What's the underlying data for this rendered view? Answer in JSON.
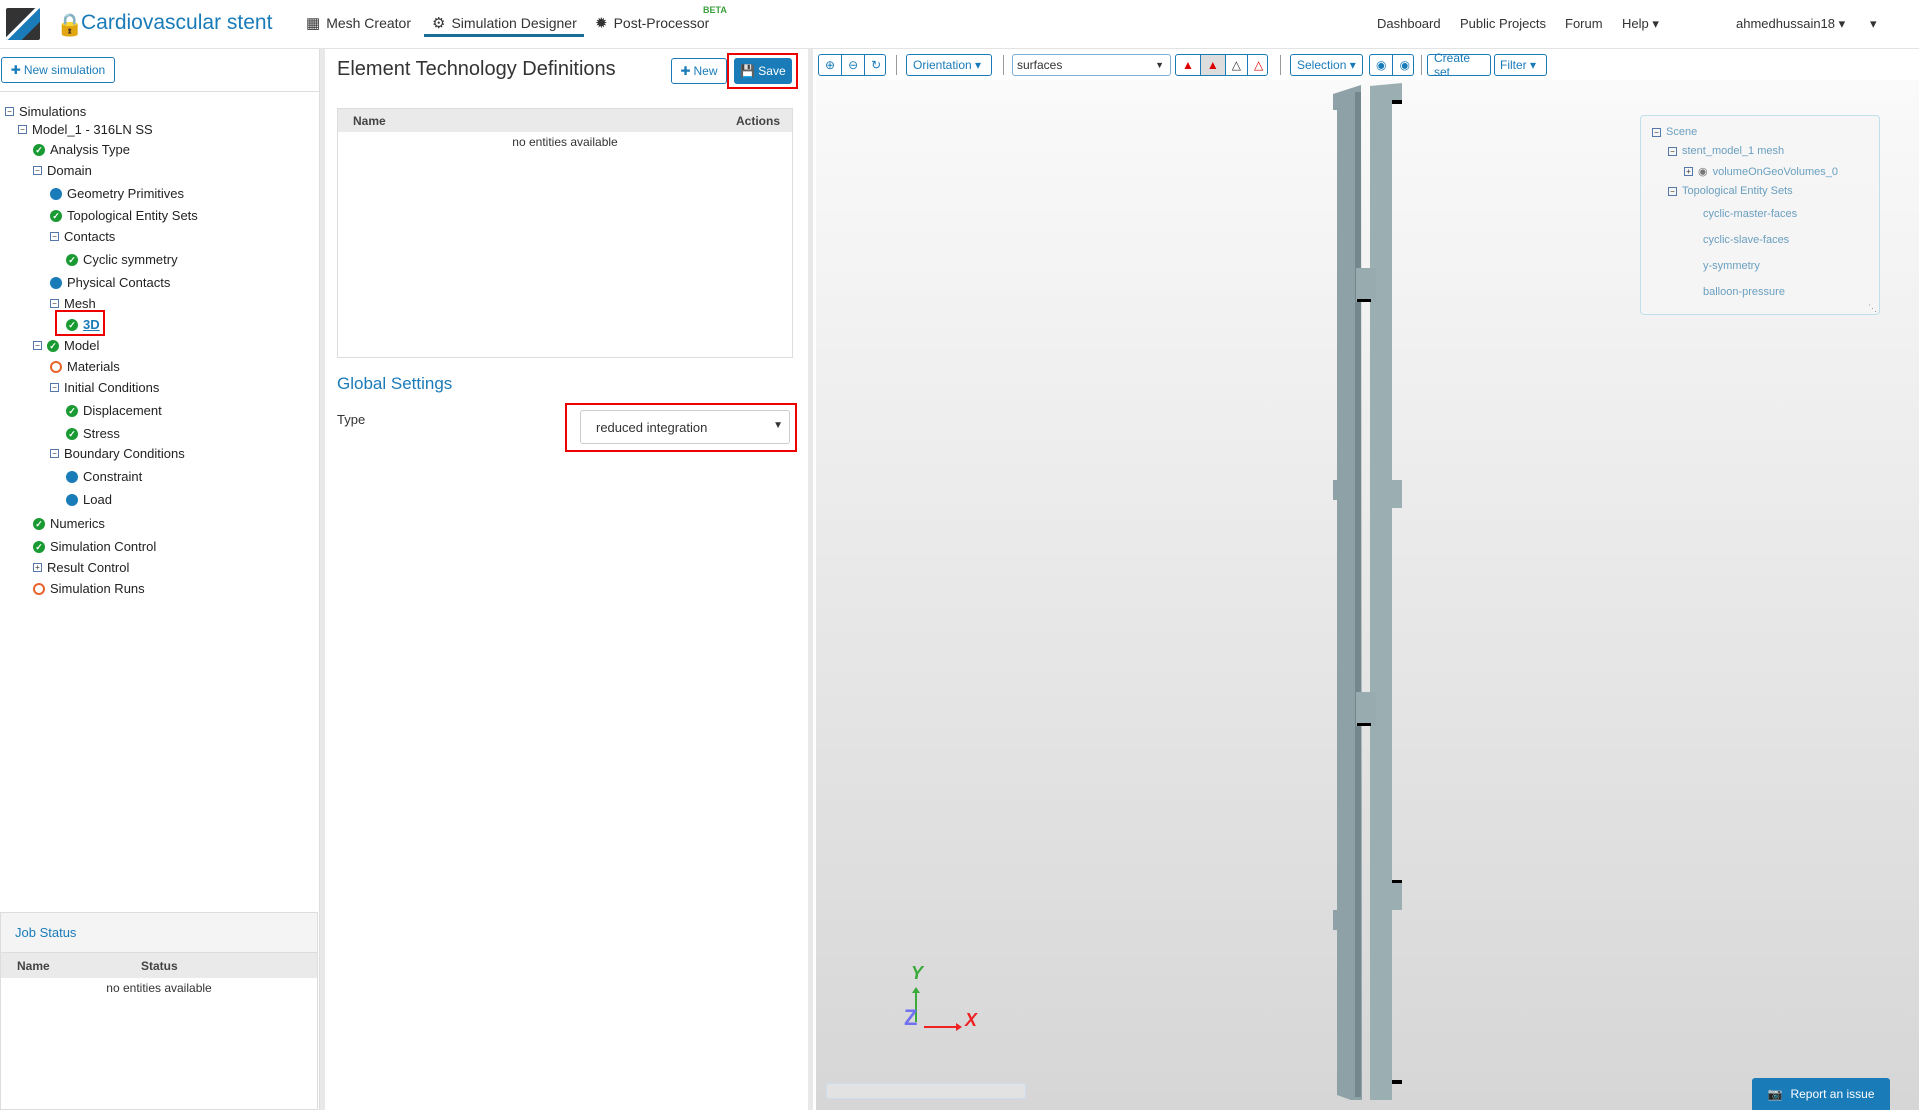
{
  "header": {
    "title": "Cardiovascular stent",
    "nav": [
      "Mesh Creator",
      "Simulation Designer",
      "Post-Processor"
    ],
    "beta": "BETA",
    "right": [
      "Dashboard",
      "Public Projects",
      "Forum",
      "Help"
    ],
    "user": "ahmedhussain18"
  },
  "sidebar": {
    "new_simulation": "New simulation",
    "tree": [
      {
        "label": "Simulations",
        "icon": "minus-box"
      },
      {
        "label": "Model_1 - 316LN SS",
        "icon": "minus-box"
      },
      {
        "label": "Analysis Type",
        "icon": "check"
      },
      {
        "label": "Domain",
        "icon": "minus-box"
      },
      {
        "label": "Geometry Primitives",
        "icon": "dot"
      },
      {
        "label": "Topological Entity Sets",
        "icon": "check"
      },
      {
        "label": "Contacts",
        "icon": "minus-box"
      },
      {
        "label": "Cyclic symmetry",
        "icon": "check"
      },
      {
        "label": "Physical Contacts",
        "icon": "dot"
      },
      {
        "label": "Mesh",
        "icon": "minus-box"
      },
      {
        "label": "3D",
        "icon": "check"
      },
      {
        "label": "Model",
        "icon": "minus-box-check"
      },
      {
        "label": "Materials",
        "icon": "ring"
      },
      {
        "label": "Initial Conditions",
        "icon": "minus-box"
      },
      {
        "label": "Displacement",
        "icon": "check"
      },
      {
        "label": "Stress",
        "icon": "check"
      },
      {
        "label": "Boundary Conditions",
        "icon": "minus-box"
      },
      {
        "label": "Constraint",
        "icon": "dot"
      },
      {
        "label": "Load",
        "icon": "dot"
      },
      {
        "label": "Numerics",
        "icon": "check"
      },
      {
        "label": "Simulation Control",
        "icon": "check"
      },
      {
        "label": "Result Control",
        "icon": "plus-box"
      },
      {
        "label": "Simulation Runs",
        "icon": "ring"
      }
    ]
  },
  "job_status": {
    "title": "Job Status",
    "columns": [
      "Name",
      "Status"
    ],
    "empty": "no entities available"
  },
  "panel": {
    "title": "Element Technology Definitions",
    "new_label": "New",
    "save_label": "Save",
    "columns": [
      "Name",
      "Actions"
    ],
    "empty": "no entities available",
    "global_settings": "Global Settings",
    "type_label": "Type",
    "type_value": "reduced integration"
  },
  "viewer": {
    "orientation": "Orientation",
    "render_mode": "surfaces",
    "selection": "Selection",
    "create_set": "Create set",
    "filter": "Filter",
    "axes": {
      "x": "X",
      "y": "Y",
      "z": "Z"
    },
    "scene": {
      "root": "Scene",
      "mesh": "stent_model_1 mesh",
      "volume": "volumeOnGeoVolumes_0",
      "sets_title": "Topological Entity Sets",
      "sets": [
        "cyclic-master-faces",
        "cyclic-slave-faces",
        "y-symmetry",
        "balloon-pressure"
      ]
    },
    "report": "Report an issue"
  },
  "colors": {
    "accent": "#1a7bb9",
    "success": "#1a9a32",
    "warning": "#e8632b",
    "highlight": "#e00000"
  }
}
